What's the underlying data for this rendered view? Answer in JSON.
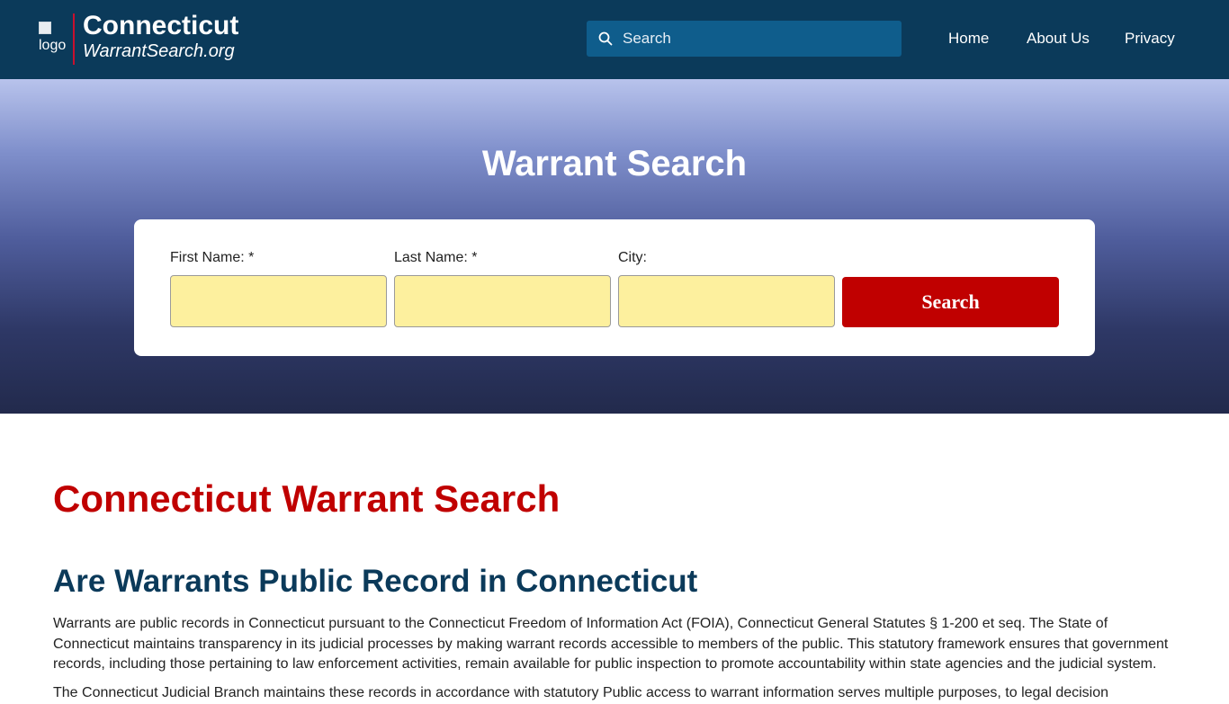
{
  "header": {
    "logo_alt": "logo",
    "brand_name": "Connecticut",
    "brand_sub": "WarrantSearch.org",
    "search_placeholder": "Search",
    "nav": [
      {
        "label": "Home"
      },
      {
        "label": "About Us"
      },
      {
        "label": "Privacy"
      }
    ]
  },
  "hero": {
    "title": "Warrant Search",
    "form": {
      "first_name_label": "First Name: *",
      "last_name_label": "Last Name: *",
      "city_label": "City:",
      "first_name_value": "",
      "last_name_value": "",
      "city_value": "",
      "submit_label": "Search"
    }
  },
  "content": {
    "title": "Connecticut Warrant Search",
    "section_title": "Are Warrants Public Record in Connecticut",
    "paragraph1": "Warrants are public records in Connecticut pursuant to the Connecticut Freedom of Information Act (FOIA), Connecticut General Statutes § 1-200 et seq. The State of Connecticut maintains transparency in its judicial processes by making warrant records accessible to members of the public. This statutory framework ensures that government records, including those pertaining to law enforcement activities, remain available for public inspection to promote accountability within state agencies and the judicial system.",
    "paragraph2": "The Connecticut Judicial Branch maintains these records in accordance with statutory Public access to warrant information serves multiple purposes, to legal decision"
  },
  "colors": {
    "header_bg": "#0b3a5a",
    "accent_red": "#c00000",
    "input_bg": "#fdf09e",
    "heading_navy": "#0b3a5a"
  },
  "icons": {
    "search": "search-icon",
    "logo": "broken-image-icon"
  }
}
